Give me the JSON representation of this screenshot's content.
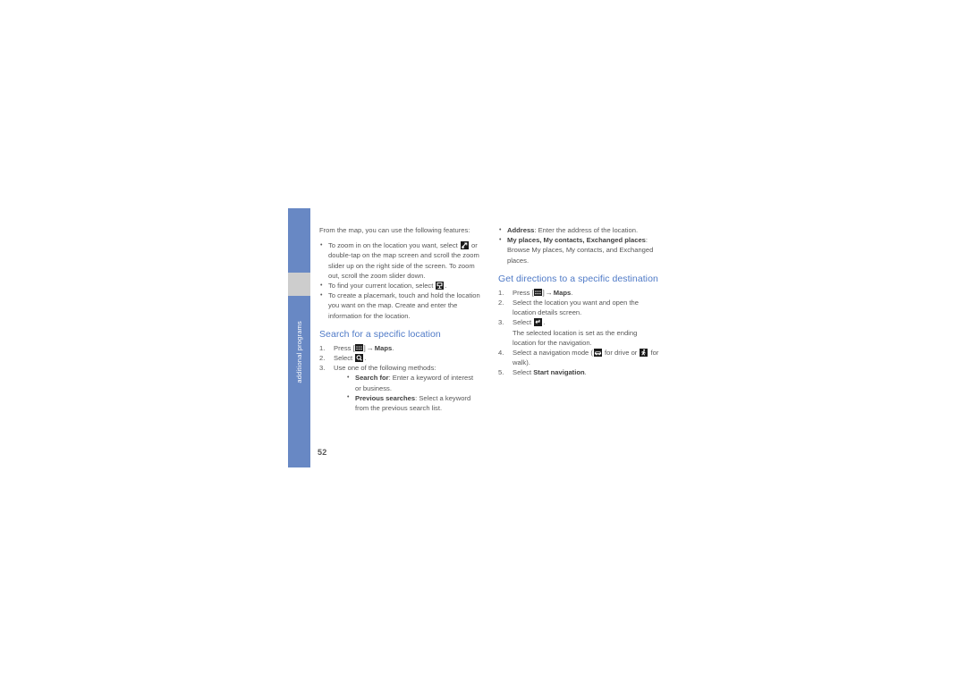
{
  "document": {
    "page_number": "52",
    "side_tab_label": "additional programs",
    "accent_color": "#4f7ac7",
    "tab_color": "#6888c4",
    "tab_gap_color": "#cdcdcd"
  },
  "left_column": {
    "intro": "From the map, you can use the following features:",
    "map_features": [
      {
        "text_before_icon": "To zoom in on the location you want, select ",
        "icon": "zoom-in-icon",
        "text_after_icon": " or double-tap on the map screen and scroll the zoom slider up on the right side of the screen. To zoom out, scroll the zoom slider down."
      },
      {
        "text_before_icon": "To find your current location, select ",
        "icon": "current-location-icon",
        "text_after_icon": "."
      },
      {
        "text_before_icon": "To create a placemark, touch and hold the location you want on the map. Create and enter the information for the location.",
        "icon": "",
        "text_after_icon": ""
      }
    ],
    "search_section": {
      "heading": "Search for a specific location",
      "step1_prefix": "Press [",
      "step1_key": "menu-key-icon",
      "step1_arrow": "→",
      "step1_bold": "Maps",
      "step1_suffix": ".",
      "step2_prefix": "Select ",
      "step2_icon": "search-magnifier-icon",
      "step2_suffix": ".",
      "step3": "Use one of the following methods:",
      "methods": [
        {
          "label": "Search for",
          "text": ": Enter a keyword of interest or business."
        },
        {
          "label": "Previous searches",
          "text": ": Select a keyword from the previous search list."
        }
      ]
    }
  },
  "right_column": {
    "methods_continued": [
      {
        "label": "Address",
        "text": ": Enter the address of the location."
      },
      {
        "label": "My places, My contacts, Exchanged places",
        "text": ": Browse My places, My contacts, and Exchanged places."
      }
    ],
    "directions_section": {
      "heading": "Get directions to a specific destination",
      "step1_prefix": "Press [",
      "step1_key": "menu-key-icon",
      "step1_arrow": "→",
      "step1_bold": "Maps",
      "step1_suffix": ".",
      "step2": "Select the location you want and open the location details screen.",
      "step3_prefix": "Select ",
      "step3_icon": "directions-arrow-icon",
      "step3_suffix": ".",
      "step3_note": "The selected location is set as the ending location for the navigation.",
      "step4_prefix": "Select a navigation mode (",
      "step4_icon_drive": "car-icon",
      "step4_mid": " for drive or ",
      "step4_icon_walk": "walk-icon",
      "step4_suffix": " for walk).",
      "step5_prefix": "Select ",
      "step5_bold": "Start navigation",
      "step5_suffix": "."
    }
  }
}
